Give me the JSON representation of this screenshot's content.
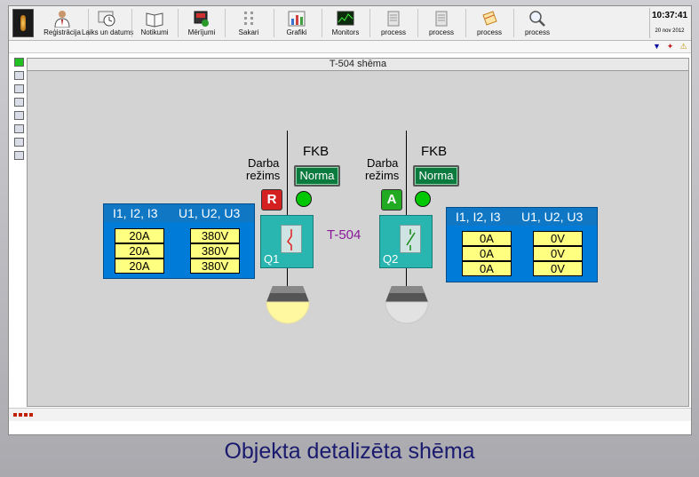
{
  "toolbar": {
    "items": [
      {
        "label": "Reģistrācija",
        "icon": "person-icon"
      },
      {
        "label": "Laiks un datums",
        "icon": "clock-icon"
      },
      {
        "label": "Notikumi",
        "icon": "book-icon"
      },
      {
        "label": "Mērījumi",
        "icon": "meter-icon"
      },
      {
        "label": "Sakari",
        "icon": "network-icon"
      },
      {
        "label": "Grafiki",
        "icon": "chart-icon"
      },
      {
        "label": "Monitors",
        "icon": "monitor-icon"
      },
      {
        "label": "process",
        "icon": "document-icon"
      },
      {
        "label": "process",
        "icon": "document-icon"
      },
      {
        "label": "process",
        "icon": "notes-icon"
      },
      {
        "label": "process",
        "icon": "magnifier-icon"
      }
    ],
    "clock": {
      "time": "10:37:41",
      "date": "20 nov 2012"
    }
  },
  "schema": {
    "title": "T-504 shēma",
    "feeder_label": "T-504",
    "left": {
      "fkb": "FKB",
      "darba": "Darba",
      "rezims": "režims",
      "norma": "Norma",
      "mode": "R",
      "mode_color": "#d42020",
      "breaker": "Q1",
      "state": "closed",
      "lamp": "on",
      "header_i": "I1, I2, I3",
      "header_u": "U1, U2, U3",
      "currents": [
        "20A",
        "20A",
        "20A"
      ],
      "voltages": [
        "380V",
        "380V",
        "380V"
      ]
    },
    "right": {
      "fkb": "FKB",
      "darba": "Darba",
      "rezims": "režims",
      "norma": "Norma",
      "mode": "A",
      "mode_color": "#22aa22",
      "breaker": "Q2",
      "state": "open",
      "lamp": "off",
      "header_i": "I1, I2, I3",
      "header_u": "U1, U2, U3",
      "currents": [
        "0A",
        "0A",
        "0A"
      ],
      "voltages": [
        "0V",
        "0V",
        "0V"
      ]
    }
  },
  "caption": "Objekta detalizēta shēma"
}
